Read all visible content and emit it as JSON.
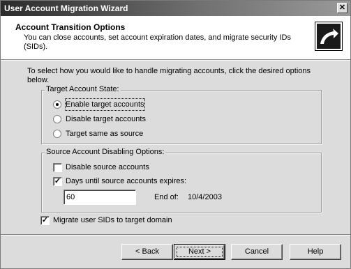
{
  "window": {
    "title": "User Account Migration Wizard",
    "close_glyph": "✕"
  },
  "header": {
    "title": "Account Transition Options",
    "subtitle": "You can close accounts, set account expiration dates, and migrate security IDs (SIDs).",
    "icon": "wizard-arrow-icon"
  },
  "intro": "To select how you would like to handle migrating accounts, click the desired options below.",
  "target_state": {
    "title": "Target Account State:",
    "options": [
      {
        "label": "Enable target accounts",
        "selected": true
      },
      {
        "label": "Disable target accounts",
        "selected": false
      },
      {
        "label": "Target same as source",
        "selected": false
      }
    ]
  },
  "source_disabling": {
    "title": "Source Account Disabling Options:",
    "disable_source": {
      "label": "Disable source accounts",
      "checked": false
    },
    "days_until_expires": {
      "label": "Days until source accounts expires:",
      "checked": true
    },
    "days_value": "60",
    "end_of_label": "End of:",
    "end_of_value": "10/4/2003"
  },
  "migrate_sids": {
    "label": "Migrate user SIDs to target domain",
    "checked": true
  },
  "buttons": {
    "back": "< Back",
    "next": "Next >",
    "cancel": "Cancel",
    "help": "Help"
  },
  "colors": {
    "dialog_bg": "#dcdcdc",
    "header_bg": "#ffffff",
    "titlebar_start": "#2b2b2b",
    "titlebar_end": "#9a9a9a"
  }
}
